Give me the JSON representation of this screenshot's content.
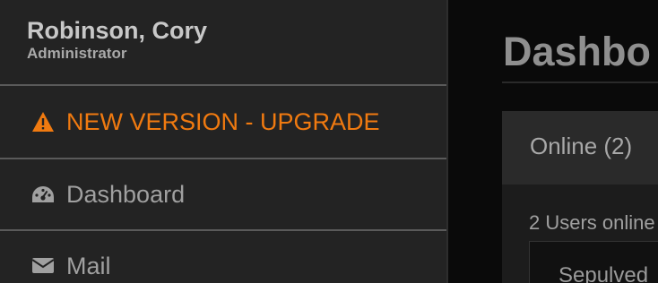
{
  "sidebar": {
    "user": {
      "name": "Robinson, Cory",
      "role": "Administrator"
    },
    "items": [
      {
        "label": "NEW VERSION - UPGRADE",
        "icon": "warning-icon",
        "color": "#f07a10"
      },
      {
        "label": "Dashboard",
        "icon": "dashboard-icon"
      },
      {
        "label": "Mail",
        "icon": "mail-icon"
      }
    ]
  },
  "main": {
    "title": "Dashbo",
    "panel": {
      "tab": "Online (2)",
      "subtitle": "2 Users online",
      "first_user": "Sepulved"
    }
  }
}
